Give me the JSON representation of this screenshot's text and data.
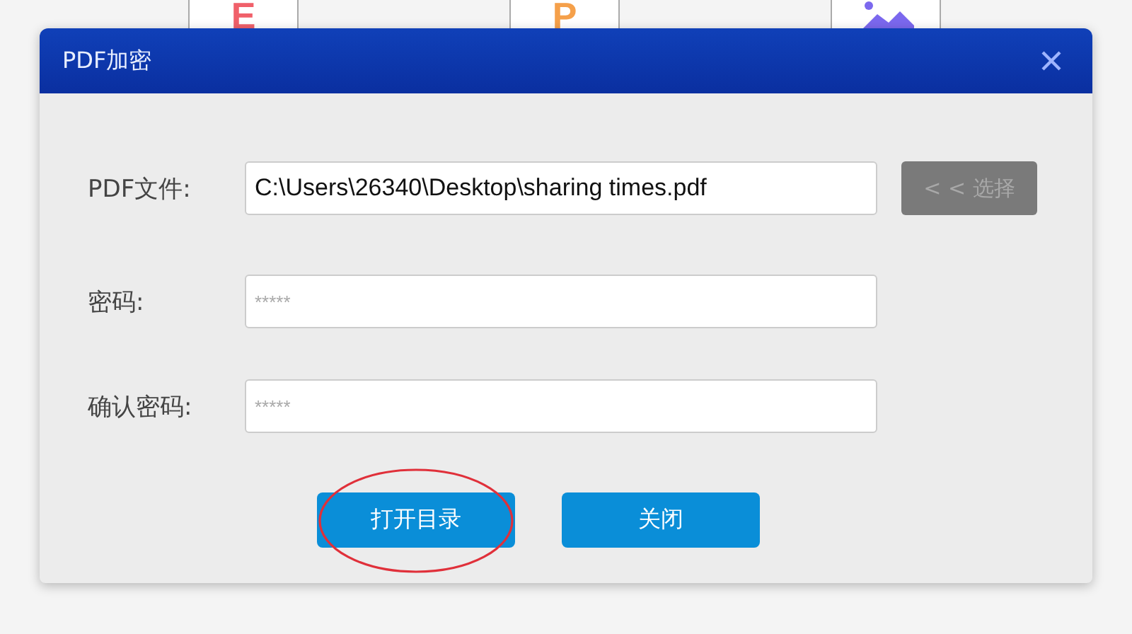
{
  "background_tiles": [
    {
      "kind": "letter",
      "letter": "E",
      "color": "#f0606a"
    },
    {
      "kind": "letter",
      "letter": "P",
      "color": "#f5a04a"
    },
    {
      "kind": "image",
      "color": "#7b68ee"
    }
  ],
  "dialog": {
    "title": "PDF加密",
    "fields": [
      {
        "label": "PDF文件:",
        "value": "C:\\Users\\26340\\Desktop\\sharing times.pdf",
        "button": {
          "label": "< < 选择",
          "disabled": true
        }
      },
      {
        "label": "密码:",
        "placeholder": "*****"
      },
      {
        "label": "确认密码:",
        "placeholder": "*****"
      }
    ],
    "buttons": [
      {
        "label": "打开目录",
        "circled": true
      },
      {
        "label": "关闭",
        "circled": false
      }
    ]
  }
}
